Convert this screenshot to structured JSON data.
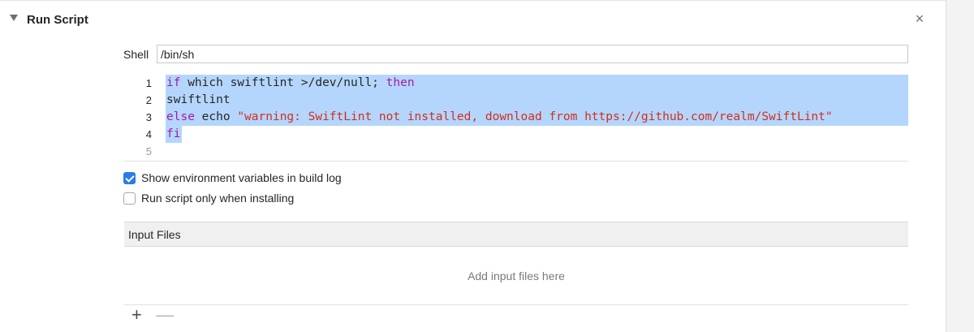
{
  "section": {
    "title": "Run Script",
    "close_glyph": "×"
  },
  "shell": {
    "label": "Shell",
    "value": "/bin/sh"
  },
  "script": {
    "line_numbers": [
      "1",
      "2",
      "3",
      "4",
      "5"
    ],
    "line1": {
      "kw1": "if",
      "mid": " which swiftlint >/dev/null; ",
      "kw2": "then"
    },
    "line2": {
      "text": "swiftlint"
    },
    "line3": {
      "kw": "else",
      "mid": " echo ",
      "str": "\"warning: SwiftLint not installed, download from https://github.com/realm/SwiftLint\""
    },
    "line4": {
      "kw": "fi"
    },
    "line5": {
      "text": ""
    },
    "selection_color": "#b4d6fd",
    "keyword_color": "#a11ca7",
    "string_color": "#d12f1b"
  },
  "options": {
    "show_env": {
      "label": "Show environment variables in build log",
      "checked": true
    },
    "install_only": {
      "label": "Run script only when installing",
      "checked": false
    }
  },
  "input_files": {
    "title": "Input Files",
    "placeholder": "Add input files here",
    "add_glyph": "+",
    "remove_glyph": "—"
  },
  "colors": {
    "accent": "#2a7ce8"
  }
}
